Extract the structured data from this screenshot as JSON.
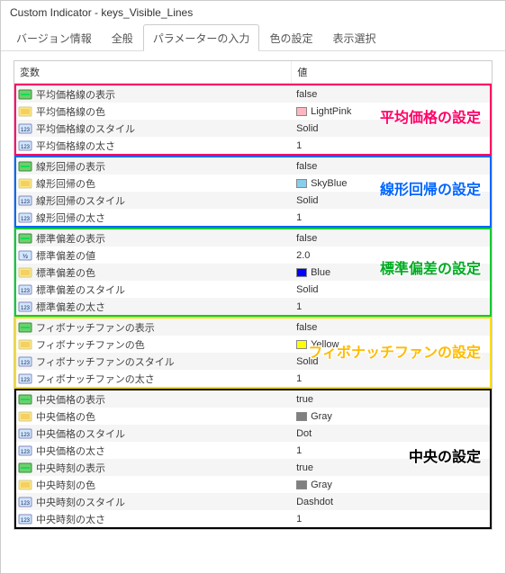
{
  "window_title": "Custom Indicator - keys_Visible_Lines",
  "tabs": [
    "バージョン情報",
    "全般",
    "パラメーターの入力",
    "色の設定",
    "表示選択"
  ],
  "active_tab": 2,
  "columns": {
    "variable": "変数",
    "value": "値"
  },
  "groups": [
    {
      "color": "pink",
      "annotation": "平均価格の設定",
      "rows": [
        {
          "icon": "bool",
          "name": "平均価格線の表示",
          "value": "false"
        },
        {
          "icon": "color",
          "name": "平均価格線の色",
          "value": "LightPink",
          "swatch": "#ffb6c1"
        },
        {
          "icon": "num",
          "name": "平均価格線のスタイル",
          "value": "Solid"
        },
        {
          "icon": "num",
          "name": "平均価格線の太さ",
          "value": "1"
        }
      ]
    },
    {
      "color": "blue",
      "annotation": "線形回帰の設定",
      "rows": [
        {
          "icon": "bool",
          "name": "線形回帰の表示",
          "value": "false"
        },
        {
          "icon": "color",
          "name": "線形回帰の色",
          "value": "SkyBlue",
          "swatch": "#87ceeb"
        },
        {
          "icon": "num",
          "name": "線形回帰のスタイル",
          "value": "Solid"
        },
        {
          "icon": "num",
          "name": "線形回帰の太さ",
          "value": "1"
        }
      ]
    },
    {
      "color": "green",
      "annotation": "標準偏差の設定",
      "rows": [
        {
          "icon": "bool",
          "name": "標準偏差の表示",
          "value": "false"
        },
        {
          "icon": "dec",
          "name": "標準偏差の値",
          "value": "2.0"
        },
        {
          "icon": "color",
          "name": "標準偏差の色",
          "value": "Blue",
          "swatch": "#0000ff"
        },
        {
          "icon": "num",
          "name": "標準偏差のスタイル",
          "value": "Solid"
        },
        {
          "icon": "num",
          "name": "標準偏差の太さ",
          "value": "1"
        }
      ]
    },
    {
      "color": "yellow",
      "annotation": "フィボナッチファンの設定",
      "rows": [
        {
          "icon": "bool",
          "name": "フィボナッチファンの表示",
          "value": "false"
        },
        {
          "icon": "color",
          "name": "フィボナッチファンの色",
          "value": "Yellow",
          "swatch": "#ffff00"
        },
        {
          "icon": "num",
          "name": "フィボナッチファンのスタイル",
          "value": "Solid"
        },
        {
          "icon": "num",
          "name": "フィボナッチファンの太さ",
          "value": "1"
        }
      ]
    },
    {
      "color": "black",
      "annotation": "中央の設定",
      "rows": [
        {
          "icon": "bool",
          "name": "中央価格の表示",
          "value": "true"
        },
        {
          "icon": "color",
          "name": "中央価格の色",
          "value": "Gray",
          "swatch": "#808080"
        },
        {
          "icon": "num",
          "name": "中央価格のスタイル",
          "value": "Dot"
        },
        {
          "icon": "num",
          "name": "中央価格の太さ",
          "value": "1"
        },
        {
          "icon": "bool",
          "name": "中央時刻の表示",
          "value": "true"
        },
        {
          "icon": "color",
          "name": "中央時刻の色",
          "value": "Gray",
          "swatch": "#808080"
        },
        {
          "icon": "num",
          "name": "中央時刻のスタイル",
          "value": "Dashdot"
        },
        {
          "icon": "num",
          "name": "中央時刻の太さ",
          "value": "1"
        }
      ]
    }
  ],
  "annotation_offsets": {
    "pink": 22,
    "blue": 22,
    "green": 30,
    "yellow": 24,
    "black": 60
  }
}
